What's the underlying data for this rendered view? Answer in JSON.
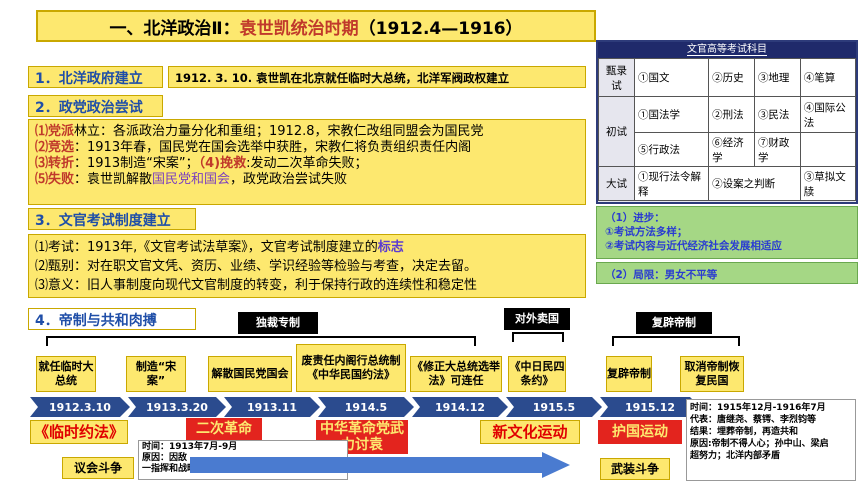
{
  "title": {
    "prefix": "一、北洋政治Ⅱ：",
    "highlight": "袁世凯统治时期",
    "suffix": "（1912.4—1916）"
  },
  "sections": {
    "s1": "1．北洋政府建立",
    "s1_note": "1912. 3. 10. 袁世凯在北京就任临时大总统，北洋军阀政权建立",
    "s2": "2．政党政治尝试",
    "s2_lines": [
      {
        "k": "⑴党派",
        "t": "林立：各派政治力量分化和重组；1912.8，宋教仁改组同盟会为国民党"
      },
      {
        "k": "⑵竞选",
        "t": "：1913年春，国民党在国会选举中获胜，宋教仁将负责组织责任内阁"
      },
      {
        "k": "⑶转折",
        "t": "：1913制造“宋案”；",
        "k2": "（4)挽救",
        "t2": ":发动二次革命失败；"
      },
      {
        "k": "⑸失败",
        "t": "：袁世凯解散",
        "p": "国民党和国会",
        "t3": "，政党政治尝试失败"
      }
    ],
    "s3": "3．文官考试制度建立",
    "s3_lines": [
      {
        "a": "⑴考试：1913年,《文官考试法草案》，文官考试制度建立的",
        "p": "标志"
      },
      {
        "a": "⑵甄别：对在职文官文凭、资历、业绩、学识经验等检验与考查，决定去留。"
      },
      {
        "a": "⑶意义：旧人事制度向现代文官制度的转变，利于保持行政的连续性和稳定性"
      }
    ],
    "s4": "4．帝制与共和肉搏"
  },
  "exam": {
    "header": "文官高等考试科目",
    "rows": [
      {
        "label": "甄录试",
        "cells": [
          "①国文",
          "②历史",
          "③地理",
          "④笔算"
        ]
      },
      {
        "label": "初试",
        "cells": [
          "①国法学",
          "②刑法",
          "③民法",
          "④国际公法"
        ]
      },
      {
        "label": "",
        "cells": [
          "⑤行政法",
          "⑥经济学",
          "⑦财政学",
          ""
        ]
      },
      {
        "label": "大试",
        "cells": [
          "①现行法令解释",
          "②设案之判断",
          "③草拟文牍"
        ]
      }
    ]
  },
  "progress": {
    "title": "（1）进步：",
    "line1": "①考试方法多样；",
    "line2": "②考试内容与近代经济社会发展相适应"
  },
  "limit": "（2）局限：男女不平等",
  "phases": {
    "dict": "独裁专制",
    "foreign": "对外卖国",
    "restore": "复辟帝制"
  },
  "events": [
    "就任临时大总统",
    "制造“宋案”",
    "解散国民党国会",
    "废责任内阁行总统制《中华民国约法》",
    "《修正大总统选举法》可连任",
    "《中日民四条约》",
    "复辟帝制",
    "取消帝制恢复民国"
  ],
  "timeline": [
    "1912.3.10",
    "1913.3.20",
    "1913.11",
    "1914.5",
    "1914.12",
    "1915.5",
    "1915.12"
  ],
  "callouts": {
    "c1": "《临时约法》",
    "c2": "二次革命",
    "c3": "中华革命党武力讨袁",
    "c4": "新文化运动",
    "c5": "护国运动",
    "left_tag": "议会斗争",
    "right_tag": "武装斗争"
  },
  "note_left": {
    "l1": "时间：1913年7月-9月",
    "l2": "原因：因敌",
    "l3": "一指挥和战略协同，失败告终"
  },
  "right_note": {
    "l1": "时间：1915年12月-1916年7月",
    "l2": "代表：唐继尧、蔡锷、李烈钧等",
    "l3": "结果：埋葬帝制，再造共和",
    "l4": "原因:帝制不得人心；孙中山、梁启",
    "l5": "超努力；北洋内部矛盾"
  }
}
